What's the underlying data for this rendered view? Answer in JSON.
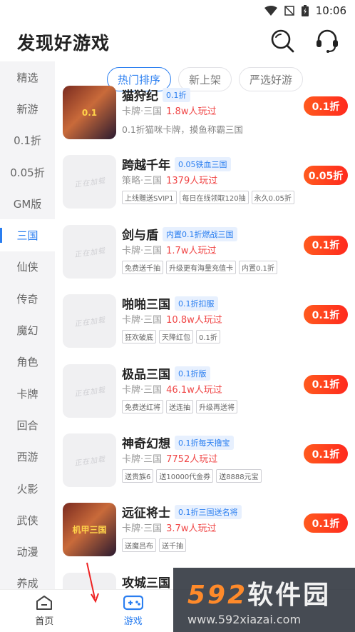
{
  "status": {
    "time": "10:06"
  },
  "header": {
    "title": "发现好游戏"
  },
  "sidebar": {
    "items": [
      "精选",
      "新游",
      "0.1折",
      "0.05折",
      "GM版",
      "三国",
      "仙侠",
      "传奇",
      "魔幻",
      "角色",
      "卡牌",
      "回合",
      "西游",
      "火影",
      "武侠",
      "动漫",
      "养成"
    ],
    "active": "三国"
  },
  "tabs": [
    {
      "label": "热门排序",
      "active": true
    },
    {
      "label": "新上架"
    },
    {
      "label": "严选好游"
    }
  ],
  "games": [
    {
      "name": "猫狩纪",
      "badge": "0.1折",
      "category": "卡牌·三国",
      "players": "1.8w人玩过",
      "desc": "0.1折猫咪卡牌，摸鱼称霸三国",
      "tags": [],
      "price": "0.1折",
      "thumb_label": "0.1"
    },
    {
      "name": "跨越千年",
      "badge": "0.05铁血三国",
      "category": "策略·三国",
      "players": "1379人玩过",
      "tags": [
        "上线赠送SVIP1",
        "每日在线领取120抽",
        "永久0.05折"
      ],
      "price": "0.05折",
      "thumb_label": "正在加载"
    },
    {
      "name": "剑与盾",
      "badge": "内置0.1折燃战三国",
      "category": "卡牌·三国",
      "players": "1.7w人玩过",
      "tags": [
        "免费送千抽",
        "升级更有海量充值卡",
        "内置0.1折"
      ],
      "price": "0.1折",
      "thumb_label": "正在加载"
    },
    {
      "name": "啪啪三国",
      "badge": "0.1折扣服",
      "category": "卡牌·三国",
      "players": "10.8w人玩过",
      "tags": [
        "狂欢破底",
        "天降红包",
        "0.1折"
      ],
      "price": "0.1折",
      "thumb_label": "正在加载"
    },
    {
      "name": "极品三国",
      "badge": "0.1折版",
      "category": "卡牌·三国",
      "players": "46.1w人玩过",
      "tags": [
        "免费送红将",
        "送连抽",
        "升级再送将"
      ],
      "price": "0.1折",
      "thumb_label": "正在加载"
    },
    {
      "name": "神奇幻想",
      "badge": "0.1折每天撸宝",
      "category": "卡牌·三国",
      "players": "7752人玩过",
      "tags": [
        "送贵族6",
        "送10000代金券",
        "送8888元宝"
      ],
      "price": "0.1折",
      "thumb_label": "正在加载"
    },
    {
      "name": "远征将士",
      "badge": "0.1折三国送名将",
      "category": "卡牌·三国",
      "players": "3.7w人玩过",
      "tags": [
        "送魔吕布",
        "送千抽"
      ],
      "price": "0.1折",
      "thumb_label": "机甲三国"
    },
    {
      "name": "攻城三国",
      "badge": "",
      "category": "",
      "players": "",
      "tags": [],
      "price": "",
      "thumb_label": ""
    }
  ],
  "bottom_nav": [
    {
      "label": "首页"
    },
    {
      "label": "游戏",
      "active": true
    }
  ],
  "watermark": {
    "brand_num": "592",
    "brand_text": "软件园",
    "url": "www.592xiazai.com"
  }
}
